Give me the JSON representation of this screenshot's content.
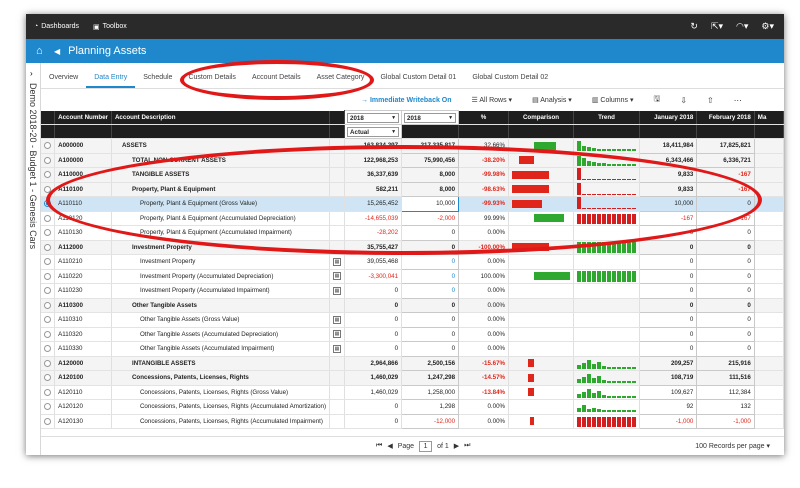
{
  "topbar": {
    "dashboards": "Dashboards",
    "toolbox": "Toolbox"
  },
  "header": {
    "title": "Planning Assets"
  },
  "sidebar": {
    "label": "Demo 2018-20 - Budget 1 - Genesis Cars"
  },
  "tabs": [
    "Overview",
    "Data Entry",
    "Schedule",
    "Custom Details",
    "Account Details",
    "Asset Category",
    "Global Custom Detail 01",
    "Global Custom Detail 02"
  ],
  "toolbar": {
    "writeback": "Immediate Writeback On",
    "rows": "All Rows",
    "analysis": "Analysis",
    "columns": "Columns"
  },
  "columns": {
    "account_number": "Account Number",
    "account_desc": "Account Description",
    "pct": "%",
    "comparison": "Comparison",
    "trend": "Trend",
    "jan": "January 2018",
    "feb": "February 2018",
    "mar": "Ma"
  },
  "selectors": {
    "year1": "2018",
    "year2": "2018",
    "scenario": "Actual"
  },
  "colors": {
    "accent": "#1f88cc",
    "negative": "#e0261b",
    "bar_red": "#e0261b",
    "bar_green": "#2ea82e",
    "annotation": "#e01818"
  },
  "rows": [
    {
      "acct": "A000000",
      "desc": "ASSETS",
      "v1": "163,834,297",
      "v2": "217,335,817",
      "pct": "32.66%",
      "jan": "18,411,984",
      "feb": "17,825,821",
      "bold": true,
      "indent": 0
    },
    {
      "acct": "A100000",
      "desc": "TOTAL NON-CURRENT ASSETS",
      "v1": "122,968,253",
      "v2": "75,990,456",
      "pct": "-38.20%",
      "jan": "6,343,466",
      "feb": "6,336,721",
      "bold": true,
      "indent": 1
    },
    {
      "acct": "A110000",
      "desc": "TANGIBLE ASSETS",
      "v1": "36,337,639",
      "v2": "8,000",
      "pct": "-99.98%",
      "jan": "9,833",
      "feb": "-167",
      "bold": true,
      "indent": 2
    },
    {
      "acct": "A110100",
      "desc": "Property, Plant & Equipment",
      "v1": "582,211",
      "v2": "8,000",
      "pct": "-98.63%",
      "jan": "9,833",
      "feb": "-167",
      "bold": true,
      "indent": 2
    },
    {
      "acct": "A110110",
      "desc": "Property, Plant & Equipment (Gross Value)",
      "v1": "15,265,452",
      "v2": "10,000",
      "pct": "-99.93%",
      "jan": "10,000",
      "feb": "0",
      "bold": false,
      "indent": 3
    },
    {
      "acct": "A110120",
      "desc": "Property, Plant & Equipment (Accumulated Depreciation)",
      "v1": "-14,655,039",
      "v2": "-2,000",
      "pct": "99.99%",
      "jan": "-167",
      "feb": "-167",
      "bold": false,
      "indent": 3
    },
    {
      "acct": "A110130",
      "desc": "Property, Plant & Equipment (Accumulated Impairment)",
      "v1": "-28,202",
      "v2": "0",
      "pct": "0.00%",
      "jan": "0",
      "feb": "0",
      "bold": false,
      "indent": 3
    },
    {
      "acct": "A112000",
      "desc": "Investment Property",
      "v1": "35,755,427",
      "v2": "0",
      "pct": "-100.00%",
      "jan": "0",
      "feb": "0",
      "bold": true,
      "indent": 2
    },
    {
      "acct": "A110210",
      "desc": "Investment Property",
      "v1": "39,055,468",
      "v2": "0",
      "pct": "0.00%",
      "jan": "0",
      "feb": "0",
      "bold": false,
      "indent": 3
    },
    {
      "acct": "A110220",
      "desc": "Investment Property (Accumulated Depreciation)",
      "v1": "-3,300,041",
      "v2": "0",
      "pct": "100.00%",
      "jan": "0",
      "feb": "0",
      "bold": false,
      "indent": 3
    },
    {
      "acct": "A110230",
      "desc": "Investment Property (Accumulated Impairment)",
      "v1": "0",
      "v2": "0",
      "pct": "0.00%",
      "jan": "0",
      "feb": "0",
      "bold": false,
      "indent": 3
    },
    {
      "acct": "A110300",
      "desc": "Other Tangible Assets",
      "v1": "0",
      "v2": "0",
      "pct": "0.00%",
      "jan": "0",
      "feb": "0",
      "bold": true,
      "indent": 2
    },
    {
      "acct": "A110310",
      "desc": "Other Tangible Assets (Gross Value)",
      "v1": "0",
      "v2": "0",
      "pct": "0.00%",
      "jan": "0",
      "feb": "0",
      "bold": false,
      "indent": 3
    },
    {
      "acct": "A110320",
      "desc": "Other Tangible Assets (Accumulated Depreciation)",
      "v1": "0",
      "v2": "0",
      "pct": "0.00%",
      "jan": "0",
      "feb": "0",
      "bold": false,
      "indent": 3
    },
    {
      "acct": "A110330",
      "desc": "Other Tangible Assets (Accumulated Impairment)",
      "v1": "0",
      "v2": "0",
      "pct": "0.00%",
      "jan": "0",
      "feb": "0",
      "bold": false,
      "indent": 3
    },
    {
      "acct": "A120000",
      "desc": "INTANGIBLE ASSETS",
      "v1": "2,964,866",
      "v2": "2,500,156",
      "pct": "-15.67%",
      "jan": "209,257",
      "feb": "215,916",
      "bold": true,
      "indent": 1
    },
    {
      "acct": "A120100",
      "desc": "Concessions, Patents, Licenses, Rights",
      "v1": "1,460,029",
      "v2": "1,247,298",
      "pct": "-14.57%",
      "jan": "108,719",
      "feb": "111,516",
      "bold": true,
      "indent": 2
    },
    {
      "acct": "A120110",
      "desc": "Concessions, Patents, Licenses, Rights (Gross Value)",
      "v1": "1,460,029",
      "v2": "1,258,000",
      "pct": "-13.84%",
      "jan": "109,627",
      "feb": "112,384",
      "bold": false,
      "indent": 3
    },
    {
      "acct": "A120120",
      "desc": "Concessions, Patents, Licenses, Rights (Accumulated Amortization)",
      "v1": "0",
      "v2": "1,298",
      "pct": "0.00%",
      "jan": "92",
      "feb": "132",
      "bold": false,
      "indent": 3
    },
    {
      "acct": "A120130",
      "desc": "Concessions, Patents, Licenses, Rights (Accumulated Impairment)",
      "v1": "0",
      "v2": "-12,000",
      "pct": "0.00%",
      "jan": "-1,000",
      "feb": "-1,000",
      "bold": false,
      "indent": 3
    }
  ],
  "pager": {
    "page_label": "Page",
    "page": "1",
    "of": "of 1",
    "records": "100 Records per page"
  }
}
